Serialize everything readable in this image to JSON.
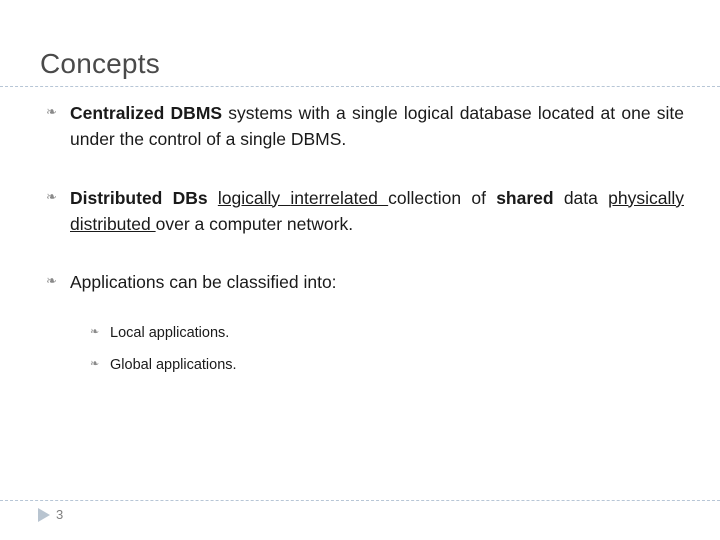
{
  "slide": {
    "title": "Concepts",
    "page_number": "3",
    "bullets": [
      {
        "level": 1,
        "marker": "❧",
        "segments": [
          {
            "text": "Centralized ",
            "bold": true,
            "underline": false
          },
          {
            "text": "DBMS ",
            "bold": true,
            "underline": false
          },
          {
            "text": "systems with a single logical database located at one site under the control of a single DBMS.",
            "bold": false,
            "underline": false
          }
        ]
      },
      {
        "level": 1,
        "marker": "❧",
        "segments": [
          {
            "text": "Distributed ",
            "bold": true,
            "underline": false
          },
          {
            "text": "DBs ",
            "bold": true,
            "underline": false
          },
          {
            "text": "logically ",
            "bold": false,
            "underline": true
          },
          {
            "text": "interrelated ",
            "bold": false,
            "underline": true
          },
          {
            "text": "collection of ",
            "bold": false,
            "underline": false
          },
          {
            "text": "shared ",
            "bold": true,
            "underline": false
          },
          {
            "text": "data ",
            "bold": false,
            "underline": false
          },
          {
            "text": "physically distributed ",
            "bold": false,
            "underline": true
          },
          {
            "text": "over a computer network.",
            "bold": false,
            "underline": false
          }
        ]
      },
      {
        "level": 1,
        "marker": "❧",
        "segments": [
          {
            "text": "Applications can be classified into:",
            "bold": false,
            "underline": false
          }
        ]
      },
      {
        "level": 2,
        "marker": "❧",
        "segments": [
          {
            "text": "Local applications.",
            "bold": false,
            "underline": false
          }
        ]
      },
      {
        "level": 2,
        "marker": "❧",
        "segments": [
          {
            "text": "Global applications.",
            "bold": false,
            "underline": false
          }
        ]
      }
    ]
  },
  "colors": {
    "title": "#4a4a4a",
    "rule": "#b7c6d6",
    "footer_arrow": "#b8c4d0",
    "page_number": "#808080",
    "text": "#1a1a1a"
  }
}
